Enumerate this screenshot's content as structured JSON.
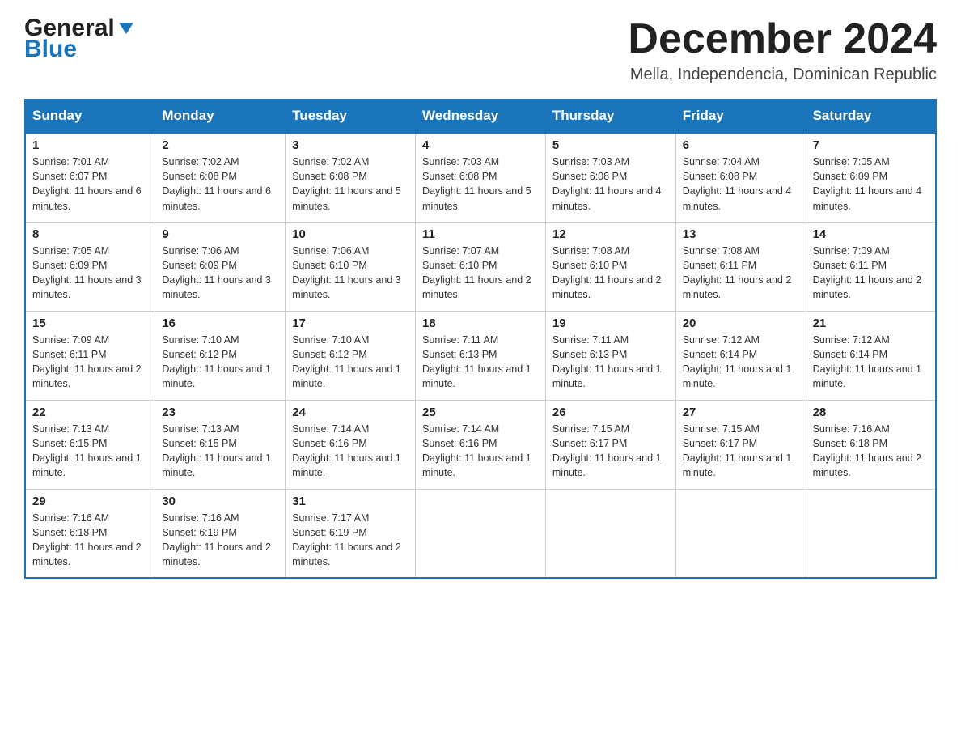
{
  "logo": {
    "general": "General",
    "blue": "Blue"
  },
  "header": {
    "month_year": "December 2024",
    "location": "Mella, Independencia, Dominican Republic"
  },
  "days_of_week": [
    "Sunday",
    "Monday",
    "Tuesday",
    "Wednesday",
    "Thursday",
    "Friday",
    "Saturday"
  ],
  "weeks": [
    [
      {
        "day": "1",
        "sunrise": "7:01 AM",
        "sunset": "6:07 PM",
        "daylight": "11 hours and 6 minutes."
      },
      {
        "day": "2",
        "sunrise": "7:02 AM",
        "sunset": "6:08 PM",
        "daylight": "11 hours and 6 minutes."
      },
      {
        "day": "3",
        "sunrise": "7:02 AM",
        "sunset": "6:08 PM",
        "daylight": "11 hours and 5 minutes."
      },
      {
        "day": "4",
        "sunrise": "7:03 AM",
        "sunset": "6:08 PM",
        "daylight": "11 hours and 5 minutes."
      },
      {
        "day": "5",
        "sunrise": "7:03 AM",
        "sunset": "6:08 PM",
        "daylight": "11 hours and 4 minutes."
      },
      {
        "day": "6",
        "sunrise": "7:04 AM",
        "sunset": "6:08 PM",
        "daylight": "11 hours and 4 minutes."
      },
      {
        "day": "7",
        "sunrise": "7:05 AM",
        "sunset": "6:09 PM",
        "daylight": "11 hours and 4 minutes."
      }
    ],
    [
      {
        "day": "8",
        "sunrise": "7:05 AM",
        "sunset": "6:09 PM",
        "daylight": "11 hours and 3 minutes."
      },
      {
        "day": "9",
        "sunrise": "7:06 AM",
        "sunset": "6:09 PM",
        "daylight": "11 hours and 3 minutes."
      },
      {
        "day": "10",
        "sunrise": "7:06 AM",
        "sunset": "6:10 PM",
        "daylight": "11 hours and 3 minutes."
      },
      {
        "day": "11",
        "sunrise": "7:07 AM",
        "sunset": "6:10 PM",
        "daylight": "11 hours and 2 minutes."
      },
      {
        "day": "12",
        "sunrise": "7:08 AM",
        "sunset": "6:10 PM",
        "daylight": "11 hours and 2 minutes."
      },
      {
        "day": "13",
        "sunrise": "7:08 AM",
        "sunset": "6:11 PM",
        "daylight": "11 hours and 2 minutes."
      },
      {
        "day": "14",
        "sunrise": "7:09 AM",
        "sunset": "6:11 PM",
        "daylight": "11 hours and 2 minutes."
      }
    ],
    [
      {
        "day": "15",
        "sunrise": "7:09 AM",
        "sunset": "6:11 PM",
        "daylight": "11 hours and 2 minutes."
      },
      {
        "day": "16",
        "sunrise": "7:10 AM",
        "sunset": "6:12 PM",
        "daylight": "11 hours and 1 minute."
      },
      {
        "day": "17",
        "sunrise": "7:10 AM",
        "sunset": "6:12 PM",
        "daylight": "11 hours and 1 minute."
      },
      {
        "day": "18",
        "sunrise": "7:11 AM",
        "sunset": "6:13 PM",
        "daylight": "11 hours and 1 minute."
      },
      {
        "day": "19",
        "sunrise": "7:11 AM",
        "sunset": "6:13 PM",
        "daylight": "11 hours and 1 minute."
      },
      {
        "day": "20",
        "sunrise": "7:12 AM",
        "sunset": "6:14 PM",
        "daylight": "11 hours and 1 minute."
      },
      {
        "day": "21",
        "sunrise": "7:12 AM",
        "sunset": "6:14 PM",
        "daylight": "11 hours and 1 minute."
      }
    ],
    [
      {
        "day": "22",
        "sunrise": "7:13 AM",
        "sunset": "6:15 PM",
        "daylight": "11 hours and 1 minute."
      },
      {
        "day": "23",
        "sunrise": "7:13 AM",
        "sunset": "6:15 PM",
        "daylight": "11 hours and 1 minute."
      },
      {
        "day": "24",
        "sunrise": "7:14 AM",
        "sunset": "6:16 PM",
        "daylight": "11 hours and 1 minute."
      },
      {
        "day": "25",
        "sunrise": "7:14 AM",
        "sunset": "6:16 PM",
        "daylight": "11 hours and 1 minute."
      },
      {
        "day": "26",
        "sunrise": "7:15 AM",
        "sunset": "6:17 PM",
        "daylight": "11 hours and 1 minute."
      },
      {
        "day": "27",
        "sunrise": "7:15 AM",
        "sunset": "6:17 PM",
        "daylight": "11 hours and 1 minute."
      },
      {
        "day": "28",
        "sunrise": "7:16 AM",
        "sunset": "6:18 PM",
        "daylight": "11 hours and 2 minutes."
      }
    ],
    [
      {
        "day": "29",
        "sunrise": "7:16 AM",
        "sunset": "6:18 PM",
        "daylight": "11 hours and 2 minutes."
      },
      {
        "day": "30",
        "sunrise": "7:16 AM",
        "sunset": "6:19 PM",
        "daylight": "11 hours and 2 minutes."
      },
      {
        "day": "31",
        "sunrise": "7:17 AM",
        "sunset": "6:19 PM",
        "daylight": "11 hours and 2 minutes."
      },
      null,
      null,
      null,
      null
    ]
  ]
}
